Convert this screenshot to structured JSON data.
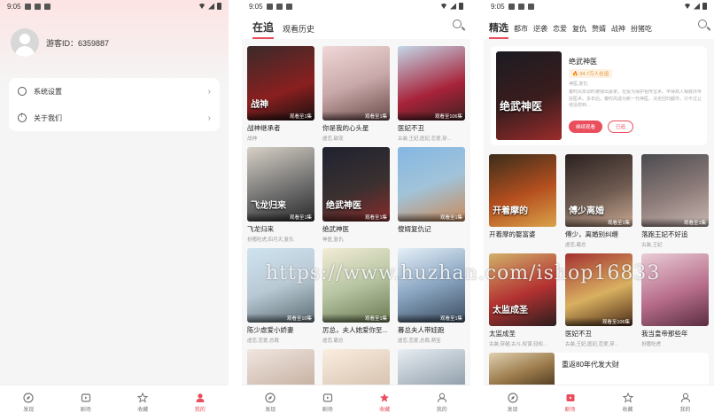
{
  "status_bar": {
    "time": "9:05"
  },
  "profile_screen": {
    "guest_id": "游客ID：6359887",
    "settings": [
      {
        "label": "系统设置",
        "icon": "gear-icon"
      },
      {
        "label": "关于我们",
        "icon": "info-icon"
      }
    ],
    "nav": [
      {
        "label": "发现",
        "icon": "compass-icon",
        "active": false
      },
      {
        "label": "剧场",
        "icon": "theater-icon",
        "active": false
      },
      {
        "label": "收藏",
        "icon": "star-icon",
        "active": false
      },
      {
        "label": "我的",
        "icon": "user-icon",
        "active": true
      }
    ]
  },
  "following_screen": {
    "tabs": [
      {
        "label": "在追",
        "active": true
      },
      {
        "label": "观看历史",
        "active": false
      }
    ],
    "items": [
      {
        "title": "战神继承者",
        "tags": "战神",
        "badge": "观看至1集",
        "poster_text": "战神"
      },
      {
        "title": "你是我的心头星",
        "tags": "虐恋,甜宠",
        "badge": "观看至1集",
        "poster_text": ""
      },
      {
        "title": "医妃不丑",
        "tags": "古装,王妃,医妃,恋爱,穿...",
        "badge": "观看至106集",
        "poster_text": ""
      },
      {
        "title": "飞龙归来",
        "tags": "扮猪吃虎,四月天,复仇",
        "badge": "观看至1集",
        "poster_text": "飞龙归来"
      },
      {
        "title": "绝武神医",
        "tags": "神医,复仇",
        "badge": "观看至1集",
        "poster_text": "绝武神医"
      },
      {
        "title": "傻婿复仇记",
        "tags": "",
        "badge": "观看至1集",
        "poster_text": ""
      },
      {
        "title": "陈少虐爱小娇妻",
        "tags": "虐恋,恋爱,总裁",
        "badge": "观看至10集",
        "poster_text": ""
      },
      {
        "title": "厉总，夫人她爱你至...",
        "tags": "虐恋,霸总",
        "badge": "观看至1集",
        "poster_text": ""
      },
      {
        "title": "暮总夫人带娃跑",
        "tags": "虐恋,恋爱,总裁,萌宝",
        "badge": "观看至1集",
        "poster_text": ""
      },
      {
        "title": "",
        "tags": "",
        "badge": "",
        "poster_text": ""
      },
      {
        "title": "",
        "tags": "",
        "badge": "",
        "poster_text": ""
      },
      {
        "title": "",
        "tags": "",
        "badge": "",
        "poster_text": ""
      }
    ],
    "nav": [
      {
        "label": "发现",
        "icon": "compass-icon",
        "active": false
      },
      {
        "label": "剧场",
        "icon": "theater-icon",
        "active": false
      },
      {
        "label": "收藏",
        "icon": "star-icon",
        "active": true
      },
      {
        "label": "我的",
        "icon": "user-icon",
        "active": false
      }
    ]
  },
  "discover_screen": {
    "tabs": [
      {
        "label": "精选",
        "active": true
      },
      {
        "label": "都市",
        "active": false
      },
      {
        "label": "逆袭",
        "active": false
      },
      {
        "label": "恋爱",
        "active": false
      },
      {
        "label": "复仇",
        "active": false
      },
      {
        "label": "赘婿",
        "active": false
      },
      {
        "label": "战神",
        "active": false
      },
      {
        "label": "扮猪吃",
        "active": false
      }
    ],
    "featured": {
      "title": "绝武神医",
      "heat": "🔥 34.7万人在追",
      "tags": "神医,复仇",
      "description": "秦时风年幼时被徐出豪家，在受为保护祖传宝术。丰得高人相救并传授医术。多年后，秦时风成为新一代神医，决定回归都市，只不过让他没想到...",
      "play_label": "继续观看",
      "fav_label": "已追",
      "poster_text": "绝武神医"
    },
    "items": [
      {
        "title": "开着摩的娶富婆",
        "tags": "",
        "badge": "",
        "poster_text": "开着摩的"
      },
      {
        "title": "傅少，离婚别纠缠",
        "tags": "虐恋,霸总",
        "badge": "观看至1集",
        "poster_text": "傅少离婚"
      },
      {
        "title": "落跑王妃不好追",
        "tags": "古装,王妃",
        "badge": "观看至1集",
        "poster_text": ""
      },
      {
        "title": "太监成圣",
        "tags": "古装,穿越,古斗,权谋,轻松...",
        "badge": "",
        "poster_text": "太监成圣"
      },
      {
        "title": "医妃不丑",
        "tags": "古装,王妃,医妃,恋爱,穿...",
        "badge": "观看至106集",
        "poster_text": ""
      },
      {
        "title": "我当皇帝那些年",
        "tags": "扮猪吃虎",
        "badge": "",
        "poster_text": ""
      }
    ],
    "next_title": "重返80年代发大财",
    "nav": [
      {
        "label": "发现",
        "icon": "compass-icon",
        "active": false
      },
      {
        "label": "剧场",
        "icon": "theater-icon",
        "active": true
      },
      {
        "label": "收藏",
        "icon": "star-icon",
        "active": false
      },
      {
        "label": "我的",
        "icon": "user-icon",
        "active": false
      }
    ]
  },
  "watermark": "https://www.huzhan.com/ishop16833",
  "colors": {
    "accent": "#e94e5c",
    "heat": "#e5962f"
  }
}
